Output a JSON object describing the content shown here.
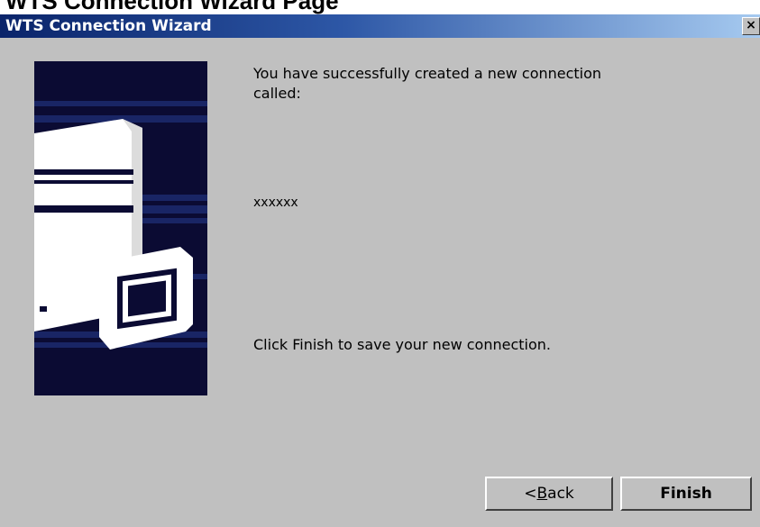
{
  "caption": "WTS Connection Wizard Page",
  "window": {
    "title": "WTS Connection Wizard",
    "close_glyph": "×"
  },
  "wizard_image": {
    "icon": "server-with-monitor-icon",
    "colors": {
      "background": "#0b0b33",
      "stripes": "#1c2a6e",
      "figure": "#ffffff"
    }
  },
  "body": {
    "created_message": "You have successfully created a new connection called:",
    "connection_name": "xxxxxx",
    "finish_message": "Click Finish to save your new connection."
  },
  "buttons": {
    "back": {
      "prefix": "<",
      "mnemonic": "B",
      "rest": "ack"
    },
    "finish": "Finish"
  },
  "colors": {
    "dialog_face": "#c0c0c0",
    "titlebar_start": "#0a246a",
    "titlebar_end": "#a6caf0",
    "title_text": "#ffffff"
  }
}
